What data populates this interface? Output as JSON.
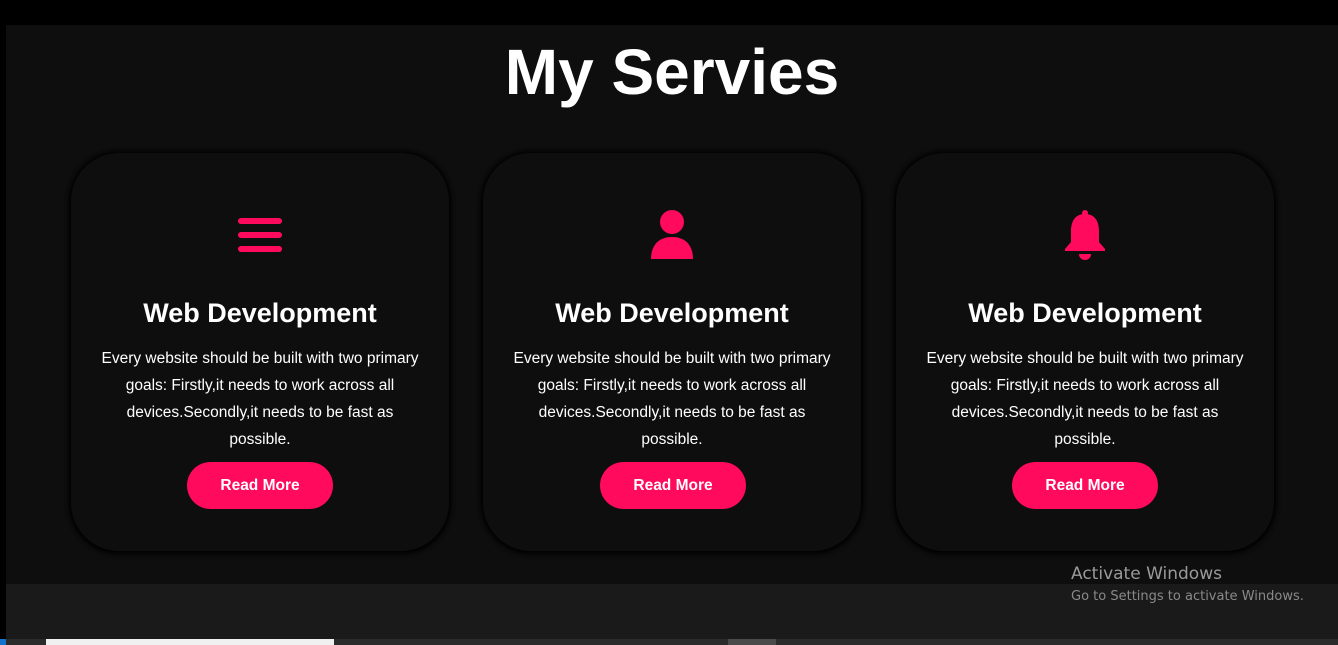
{
  "page": {
    "title": "My Servies"
  },
  "services": [
    {
      "icon": "menu-bars-icon",
      "title": "Web Development",
      "description": "Every website should be built with two primary goals: Firstly,it needs to work across all devices.Secondly,it needs to be fast as possible.",
      "button_label": "Read More"
    },
    {
      "icon": "user-icon",
      "title": "Web Development",
      "description": "Every website should be built with two primary goals: Firstly,it needs to work across all devices.Secondly,it needs to be fast as possible.",
      "button_label": "Read More"
    },
    {
      "icon": "bell-icon",
      "title": "Web Development",
      "description": "Every website should be built with two primary goals: Firstly,it needs to work across all devices.Secondly,it needs to be fast as possible.",
      "button_label": "Read More"
    }
  ],
  "watermark": {
    "title": "Activate Windows",
    "subtitle": "Go to Settings to activate Windows."
  },
  "colors": {
    "accent": "#ff0a5c",
    "background": "#0e0e0e",
    "text": "#ffffff"
  }
}
